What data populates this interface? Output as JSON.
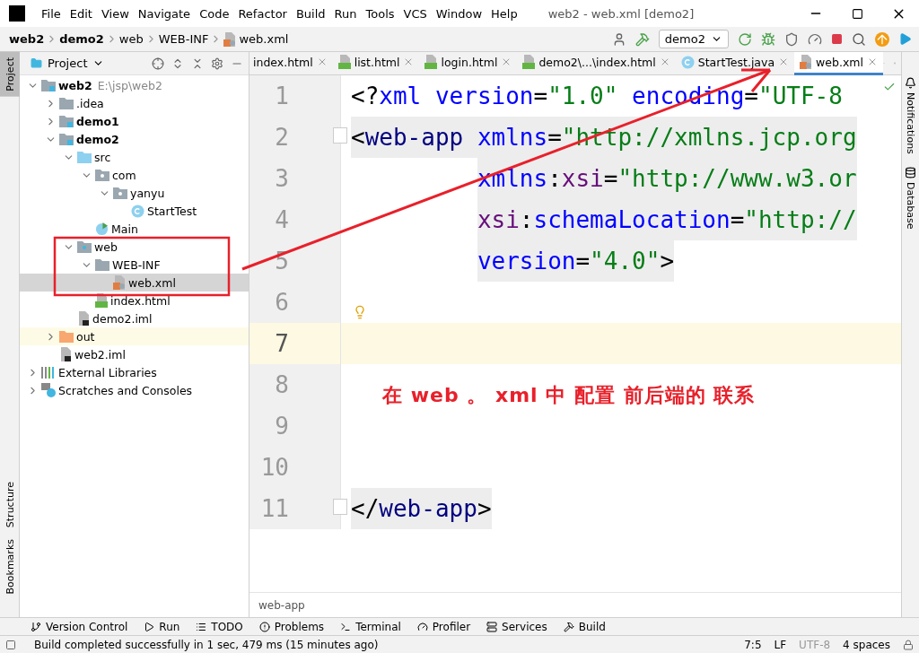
{
  "window": {
    "title": "web2 - web.xml [demo2]"
  },
  "menu": [
    "File",
    "Edit",
    "View",
    "Navigate",
    "Code",
    "Refactor",
    "Build",
    "Run",
    "Tools",
    "VCS",
    "Window",
    "Help"
  ],
  "breadcrumbs": [
    {
      "label": "web2",
      "bold": true
    },
    {
      "label": "demo2",
      "bold": true
    },
    {
      "label": "web",
      "bold": false
    },
    {
      "label": "WEB-INF",
      "bold": false
    },
    {
      "label": "web.xml",
      "bold": false,
      "kind": "xml"
    }
  ],
  "run_config": "demo2",
  "left_stripe": [
    {
      "label": "Project",
      "selected": true
    },
    {
      "label": "Structure",
      "selected": false
    },
    {
      "label": "Bookmarks",
      "selected": false
    }
  ],
  "right_stripe": [
    "Notifications",
    "Database"
  ],
  "project_panel": {
    "title": "Project"
  },
  "tree": [
    {
      "label": "web2",
      "path": "E:\\jsp\\web2",
      "kind": "module",
      "bold": true,
      "expanded": true,
      "children": [
        {
          "label": ".idea",
          "kind": "folder",
          "expanded": false
        },
        {
          "label": "demo1",
          "kind": "module",
          "bold": true,
          "expanded": false
        },
        {
          "label": "demo2",
          "kind": "module",
          "bold": true,
          "expanded": true,
          "children": [
            {
              "label": "src",
              "kind": "source-folder",
              "expanded": true,
              "children": [
                {
                  "label": "com",
                  "kind": "package",
                  "expanded": true,
                  "children": [
                    {
                      "label": "yanyu",
                      "kind": "package",
                      "expanded": true,
                      "children": [
                        {
                          "label": "StartTest",
                          "kind": "class"
                        }
                      ]
                    }
                  ]
                },
                {
                  "label": "Main",
                  "kind": "main-class"
                }
              ]
            },
            {
              "label": "web",
              "kind": "web-folder",
              "expanded": true,
              "children": [
                {
                  "label": "WEB-INF",
                  "kind": "folder",
                  "expanded": true,
                  "children": [
                    {
                      "label": "web.xml",
                      "kind": "xml",
                      "selected": true
                    }
                  ]
                },
                {
                  "label": "index.html",
                  "kind": "html"
                }
              ]
            },
            {
              "label": "demo2.iml",
              "kind": "iml"
            }
          ]
        },
        {
          "label": "out",
          "kind": "excluded-folder",
          "expanded": false,
          "highlighted": true
        },
        {
          "label": "web2.iml",
          "kind": "iml"
        }
      ]
    },
    {
      "label": "External Libraries",
      "kind": "libraries",
      "expanded": false
    },
    {
      "label": "Scratches and Consoles",
      "kind": "scratches",
      "expanded": false
    }
  ],
  "tabs": [
    {
      "label": "index.html",
      "selected": false
    },
    {
      "label": "list.html",
      "kind": "html",
      "selected": false
    },
    {
      "label": "login.html",
      "kind": "html",
      "selected": false
    },
    {
      "label": "demo2\\...\\index.html",
      "kind": "html",
      "selected": false
    },
    {
      "label": "StartTest.java",
      "kind": "java",
      "selected": false
    },
    {
      "label": "web.xml",
      "kind": "xml",
      "selected": true
    }
  ],
  "code": [
    {
      "number": "1",
      "tokens": [
        {
          "kind": "punct",
          "text": "<?"
        },
        {
          "kind": "attr",
          "text": "xml version"
        },
        {
          "kind": "punct",
          "text": "="
        },
        {
          "kind": "value",
          "text": "\"1.0\""
        },
        {
          "kind": "attr",
          "text": " encoding"
        },
        {
          "kind": "punct",
          "text": "="
        },
        {
          "kind": "value",
          "text": "\"UTF-8"
        }
      ]
    },
    {
      "number": "2",
      "fold": true,
      "highlighted": true,
      "tokens": [
        {
          "kind": "punct",
          "text": "<"
        },
        {
          "kind": "tag",
          "text": "web-app"
        },
        {
          "kind": "attr",
          "text": " xmlns"
        },
        {
          "kind": "punct",
          "text": "="
        },
        {
          "kind": "value",
          "text": "\"http://xmlns.jcp.org"
        }
      ]
    },
    {
      "number": "3",
      "continuation": true,
      "highlighted": true,
      "tokens": [
        {
          "kind": "attr",
          "text": "xmlns"
        },
        {
          "kind": "punct",
          "text": ":"
        },
        {
          "kind": "ns",
          "text": "xsi"
        },
        {
          "kind": "punct",
          "text": "="
        },
        {
          "kind": "value",
          "text": "\"http://www.w3.or"
        }
      ]
    },
    {
      "number": "4",
      "continuation": true,
      "highlighted": true,
      "tokens": [
        {
          "kind": "ns",
          "text": "xsi"
        },
        {
          "kind": "punct",
          "text": ":"
        },
        {
          "kind": "attr",
          "text": "schemaLocation"
        },
        {
          "kind": "punct",
          "text": "="
        },
        {
          "kind": "value",
          "text": "\"http://"
        }
      ]
    },
    {
      "number": "5",
      "continuation": true,
      "highlighted": true,
      "tokens": [
        {
          "kind": "attr",
          "text": "version"
        },
        {
          "kind": "punct",
          "text": "="
        },
        {
          "kind": "value",
          "text": "\"4.0\""
        },
        {
          "kind": "punct",
          "text": ">"
        }
      ]
    },
    {
      "number": "6",
      "bulb": true
    },
    {
      "number": "7",
      "current": true
    },
    {
      "number": "8"
    },
    {
      "number": "9"
    },
    {
      "number": "10"
    },
    {
      "number": "11",
      "fold": true,
      "highlighted": true,
      "tokens": [
        {
          "kind": "punct",
          "text": "</"
        },
        {
          "kind": "tag",
          "text": "web-app"
        },
        {
          "kind": "punct",
          "text": ">"
        }
      ]
    }
  ],
  "editor_breadcrumb": "web-app",
  "annotation": {
    "note": "在 web 。 xml 中 配置 前后端的 联系"
  },
  "tool_windows": [
    "Version Control",
    "Run",
    "TODO",
    "Problems",
    "Terminal",
    "Profiler",
    "Services",
    "Build"
  ],
  "status_bar": {
    "message": "Build completed successfully in 1 sec, 479 ms (15 minutes ago)",
    "position": "7:5",
    "line_separator": "LF",
    "encoding": "UTF-8",
    "indent": "4 spaces"
  }
}
